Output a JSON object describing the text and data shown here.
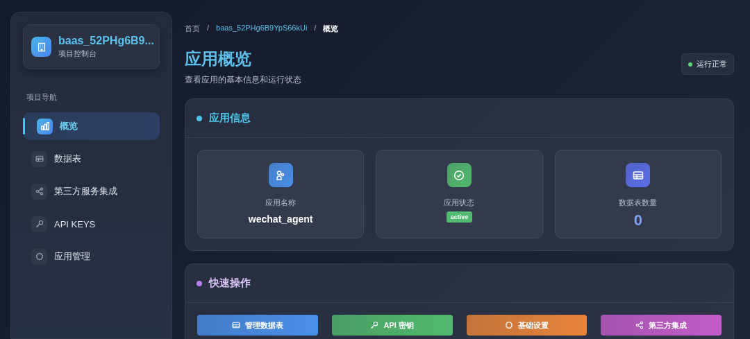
{
  "project": {
    "name": "baas_52PHg6B9...",
    "subtitle": "项目控制台"
  },
  "nav_heading": "项目导航",
  "nav_items": [
    {
      "label": "概览",
      "selected": true
    },
    {
      "label": "数据表",
      "selected": false
    },
    {
      "label": "第三方服务集成",
      "selected": false
    },
    {
      "label": "API KEYS",
      "selected": false
    },
    {
      "label": "应用管理",
      "selected": false
    }
  ],
  "breadcrumb": [
    "首页",
    "baas_52PHg6B9YpS66kUi",
    "概览"
  ],
  "breadcrumb_separator": "/",
  "page_title": "应用概览",
  "page_subtitle": "查看应用的基本信息和运行状态",
  "status": {
    "label": "运行正常",
    "color": "#5fd37a"
  },
  "app_info": {
    "title": "应用信息",
    "color": "#4fc3e8",
    "cards": [
      {
        "label": "应用名称",
        "value": "wechat_agent",
        "kind": "text",
        "color": "#4a8fe8"
      },
      {
        "label": "应用状态",
        "value": "active",
        "kind": "badge",
        "color": "#52b96e"
      },
      {
        "label": "数据表数量",
        "value": "0",
        "kind": "number",
        "color": "#5a6ee8"
      }
    ]
  },
  "quick_actions": {
    "title": "快速操作",
    "color": "#b57df0",
    "buttons": [
      {
        "label": "管理数据表",
        "color": "#4a8fe8"
      },
      {
        "label": "API 密钥",
        "color": "#52b96e"
      },
      {
        "label": "基础设置",
        "color": "#e8843a"
      },
      {
        "label": "第三方集成",
        "color": "#c25cc8"
      }
    ]
  }
}
